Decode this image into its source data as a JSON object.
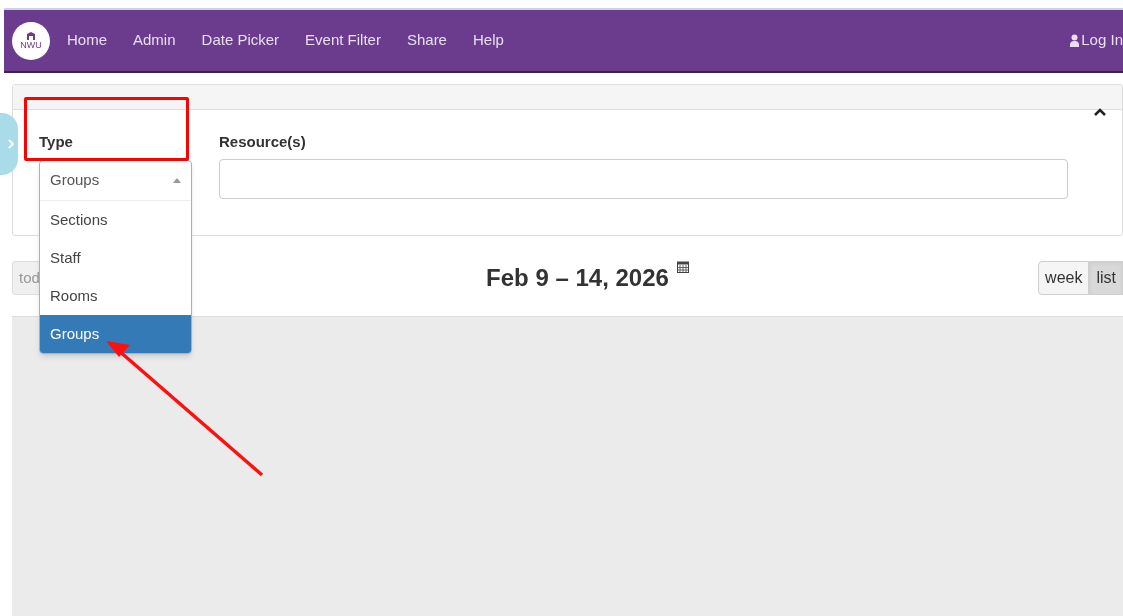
{
  "navbar": {
    "logo": "NWU",
    "items": [
      {
        "label": "Home"
      },
      {
        "label": "Admin"
      },
      {
        "label": "Date Picker"
      },
      {
        "label": "Event Filter"
      },
      {
        "label": "Share"
      },
      {
        "label": "Help"
      }
    ],
    "login": "Log In"
  },
  "filter_panel": {
    "expanded": true,
    "type_label": "Type",
    "type_value": "Groups",
    "type_options": [
      {
        "label": "Sections",
        "selected": false
      },
      {
        "label": "Staff",
        "selected": false
      },
      {
        "label": "Rooms",
        "selected": false
      },
      {
        "label": "Groups",
        "selected": true
      }
    ],
    "resources_label": "Resource(s)"
  },
  "calendar": {
    "today_button": "tod",
    "title": "Feb 9 – 14, 2026",
    "views": [
      {
        "label": "week",
        "selected": false
      },
      {
        "label": "list",
        "selected": true
      }
    ]
  }
}
